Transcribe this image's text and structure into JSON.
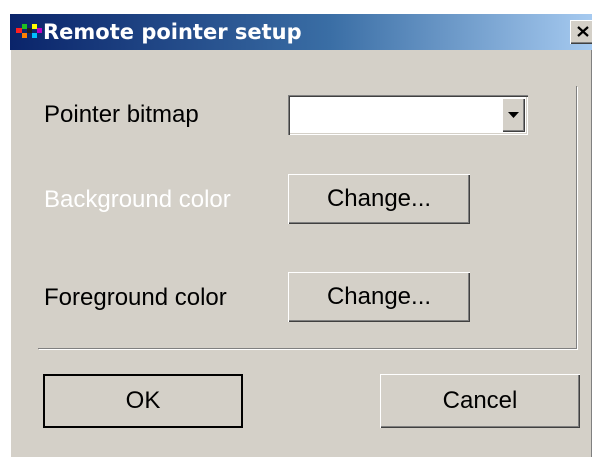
{
  "window": {
    "title": "Remote pointer setup",
    "icon": "remote-pointer-app-icon",
    "close_icon": "close-icon"
  },
  "form": {
    "pointer_bitmap": {
      "label": "Pointer bitmap",
      "value": "",
      "dropdown_icon": "chevron-down-icon"
    },
    "background_color": {
      "label": "Background color",
      "disabled": true,
      "button_label": "Change..."
    },
    "foreground_color": {
      "label": "Foreground color",
      "button_label": "Change..."
    }
  },
  "actions": {
    "ok_label": "OK",
    "cancel_label": "Cancel"
  },
  "colors": {
    "dialog_face": "#d4d0c8",
    "title_gradient_start": "#0a246a",
    "title_gradient_end": "#a6caf0",
    "disabled_text": "#ffffff"
  }
}
